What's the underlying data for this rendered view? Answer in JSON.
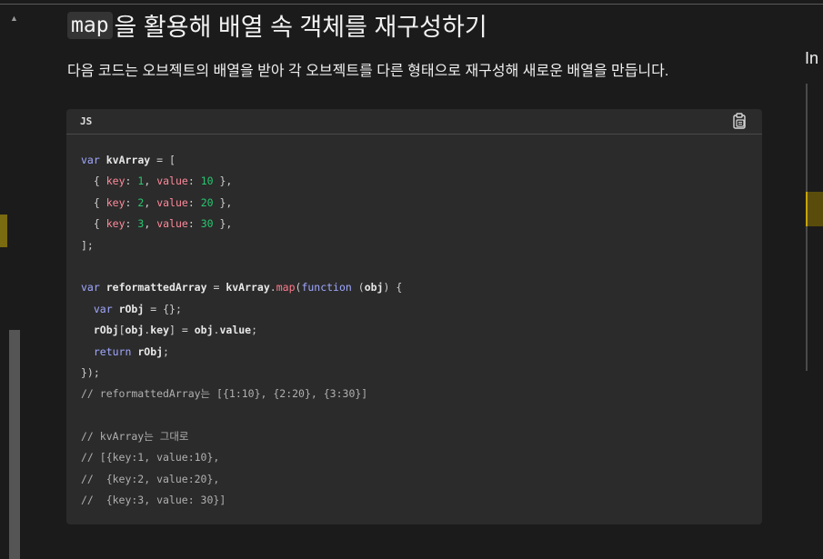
{
  "section": {
    "title_code": "map",
    "title_rest": "을 활용해 배열 속 객체를 재구성하기",
    "description": "다음 코드는 오브젝트의 배열을 받아 각 오브젝트를 다른 형태으로 재구성해 새로운 배열을 만듭니다."
  },
  "code_block": {
    "language": "JS",
    "copy_icon": "clipboard-icon"
  },
  "toc": {
    "label": "In"
  },
  "colors": {
    "keyword": "#a0a8ff",
    "property": "#ff8a9a",
    "number": "#28c76f",
    "background": "#1b1b1b",
    "code_bg": "#2b2b2b"
  }
}
